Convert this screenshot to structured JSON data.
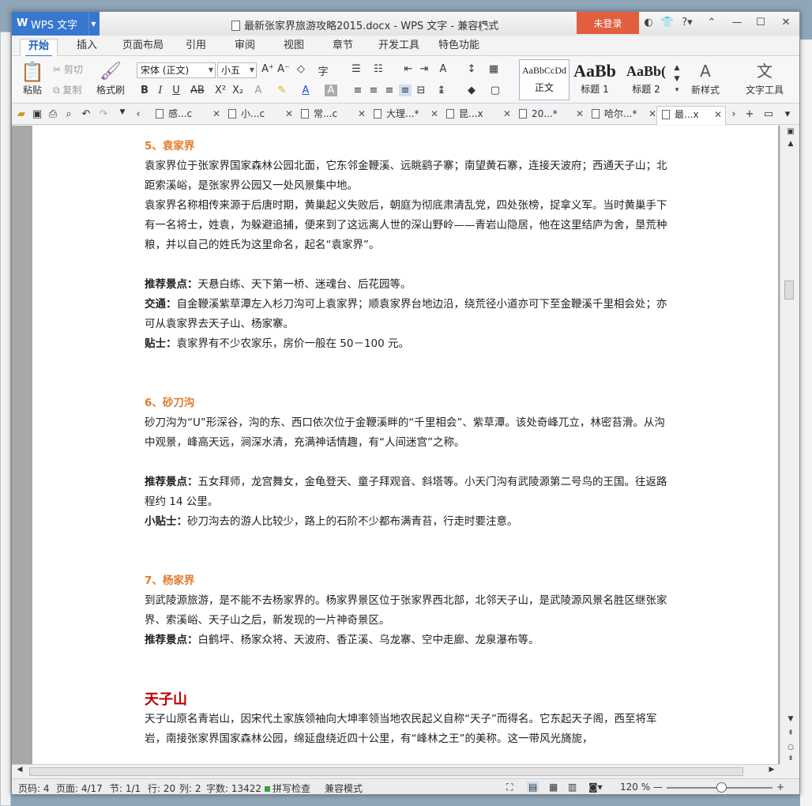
{
  "window": {
    "app_name": "WPS 文字",
    "title": "最新张家界旅游攻略2015.docx - WPS 文字 - 兼容模式",
    "login": "未登录"
  },
  "menu": {
    "tabs": [
      "开始",
      "插入",
      "页面布局",
      "引用",
      "审阅",
      "视图",
      "章节",
      "开发工具",
      "特色功能"
    ]
  },
  "ribbon": {
    "paste": "粘贴",
    "cut": "剪切",
    "copy": "复制",
    "format_painter": "格式刷",
    "font_name": "宋体 (正文)",
    "font_size": "小五",
    "styles": [
      {
        "preview": "AaBbCcDd",
        "label": "正文"
      },
      {
        "preview": "AaBb",
        "label": "标题 1"
      },
      {
        "preview": "AaBb(",
        "label": "标题 2"
      }
    ],
    "new_style": "新样式",
    "text_tools": "文字工具"
  },
  "doc_tabs": [
    {
      "label": "感...c"
    },
    {
      "label": "小...c"
    },
    {
      "label": "常...c"
    },
    {
      "label": "大理...*"
    },
    {
      "label": "昆...x"
    },
    {
      "label": "20...*"
    },
    {
      "label": "哈尔...*"
    },
    {
      "label": "最...x"
    }
  ],
  "document": {
    "s5_title": "5、袁家界",
    "s5_p1": "袁家界位于张家界国家森林公园北面，它东邻金鞭溪、远眺鹞子寨；南望黄石寨，连接天波府；西通天子山；北距索溪峪，是张家界公园又一处风景集中地。",
    "s5_p2": "袁家界名称相传来源于后唐时期，黄巢起义失败后，朝庭为彻底肃清乱党，四处张榜，捉拿义军。当时黄巢手下有一名将士，姓袁，为躲避追捕，便来到了这远离人世的深山野岭——青岩山隐居，他在这里结庐为舍，垦荒种粮，并以自己的姓氏为这里命名，起名“袁家界”。",
    "s5_rec_label": "推荐景点：",
    "s5_rec": "天悬白练、天下第一桥、迷魂台、后花园等。",
    "s5_traffic_label": "交通：",
    "s5_traffic": "自金鞭溪紫草潭左入杉刀沟可上袁家界；顺袁家界台地边沿，绕荒径小道亦可下至金鞭溪千里相会处；亦可从袁家界去天子山、杨家寨。",
    "s5_tip_label": "贴士：",
    "s5_tip": "袁家界有不少农家乐，房价一般在 50－100  元。",
    "s6_title": "6、砂刀沟",
    "s6_p1": "砂刀沟为“U”形深谷，沟的东、西口依次位于金鞭溪畔的“千里相会”、紫草潭。该处奇峰兀立，林密苔滑。从沟中观景，峰高天远，涧深水清，充满神话情趣，有“人间迷宫”之称。",
    "s6_rec_label": "推荐景点：",
    "s6_rec": "五女拜师，龙宫舞女，金龟登天、童子拜观音、斜塔等。小天门沟有武陵源第二号鸟的王国。往返路程约 14 公里。",
    "s6_tip_label": "小贴士：",
    "s6_tip": "砂刀沟去的游人比较少，路上的石阶不少都布满青苔，行走时要注意。",
    "s7_title": "7、杨家界",
    "s7_p1": "到武陵源旅游，是不能不去杨家界的。杨家界景区位于张家界西北部，北邻天子山，是武陵源风景名胜区继张家界、索溪峪、天子山之后，新发现的一片神奇景区。",
    "s7_rec_label": "推荐景点：",
    "s7_rec": "白鹤坪、杨家众将、天波府、香芷溪、乌龙寨、空中走廊、龙泉瀑布等。",
    "tz_title": "天子山",
    "tz_p1": "天子山原名青岩山，因宋代土家族领袖向大坤率领当地农民起义自称“天子”而得名。它东起天子阁，西至将军岩，南接张家界国家森林公园，绵延盘绕近四十公里，有“峰林之王”的美称。这一带风光旖旎，"
  },
  "status": {
    "page_num": "页码: 4",
    "pages": "页面: 4/17",
    "section": "节: 1/1",
    "row": "行: 20",
    "col": "列: 2",
    "words": "字数: 13422",
    "spell": "拼写检查",
    "mode": "兼容模式",
    "zoom": "120 %"
  }
}
